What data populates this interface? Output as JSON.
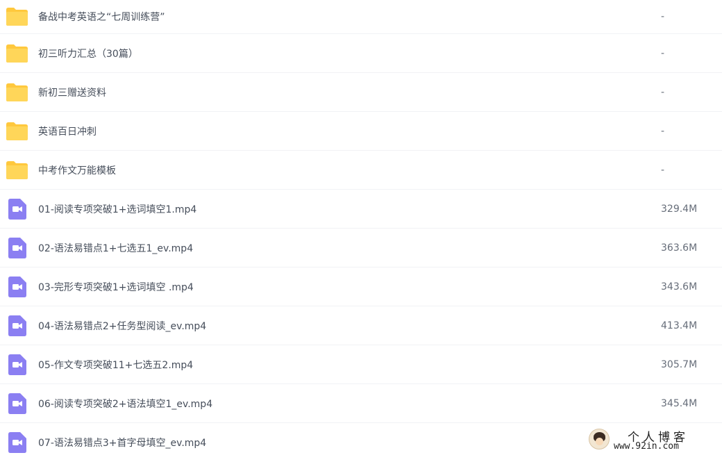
{
  "files": [
    {
      "type": "folder",
      "icon": "folder-icon",
      "name": "备战中考英语之“七周训练营”",
      "size": "-"
    },
    {
      "type": "folder",
      "icon": "folder-icon",
      "name": "初三听力汇总（30篇）",
      "size": "-"
    },
    {
      "type": "folder",
      "icon": "folder-icon",
      "name": "新初三赠送资料",
      "size": "-"
    },
    {
      "type": "folder",
      "icon": "folder-icon",
      "name": "英语百日冲刺",
      "size": "-"
    },
    {
      "type": "folder",
      "icon": "folder-icon",
      "name": "中考作文万能模板",
      "size": "-"
    },
    {
      "type": "video",
      "icon": "video-icon",
      "name": "01-阅读专项突破1+选词填空1.mp4",
      "size": "329.4M"
    },
    {
      "type": "video",
      "icon": "video-icon",
      "name": "02-语法易错点1+七选五1_ev.mp4",
      "size": "363.6M"
    },
    {
      "type": "video",
      "icon": "video-icon",
      "name": "03-完形专项突破1+选词填空 .mp4",
      "size": "343.6M"
    },
    {
      "type": "video",
      "icon": "video-icon",
      "name": "04-语法易错点2+任务型阅读_ev.mp4",
      "size": "413.4M"
    },
    {
      "type": "video",
      "icon": "video-icon",
      "name": "05-作文专项突破11+七选五2.mp4",
      "size": "305.7M"
    },
    {
      "type": "video",
      "icon": "video-icon",
      "name": "06-阅读专项突破2+语法填空1_ev.mp4",
      "size": "345.4M"
    },
    {
      "type": "video",
      "icon": "video-icon",
      "name": "07-语法易错点3+首字母填空_ev.mp4",
      "size": ""
    }
  ],
  "watermark": {
    "title": "个人博客",
    "url": "www.92in.com"
  },
  "colors": {
    "folder": "#ffd659",
    "folder_tab": "#ffc83d",
    "video": "#8b7ff2",
    "text": "#454d5a",
    "divider": "#f1f2f5"
  }
}
